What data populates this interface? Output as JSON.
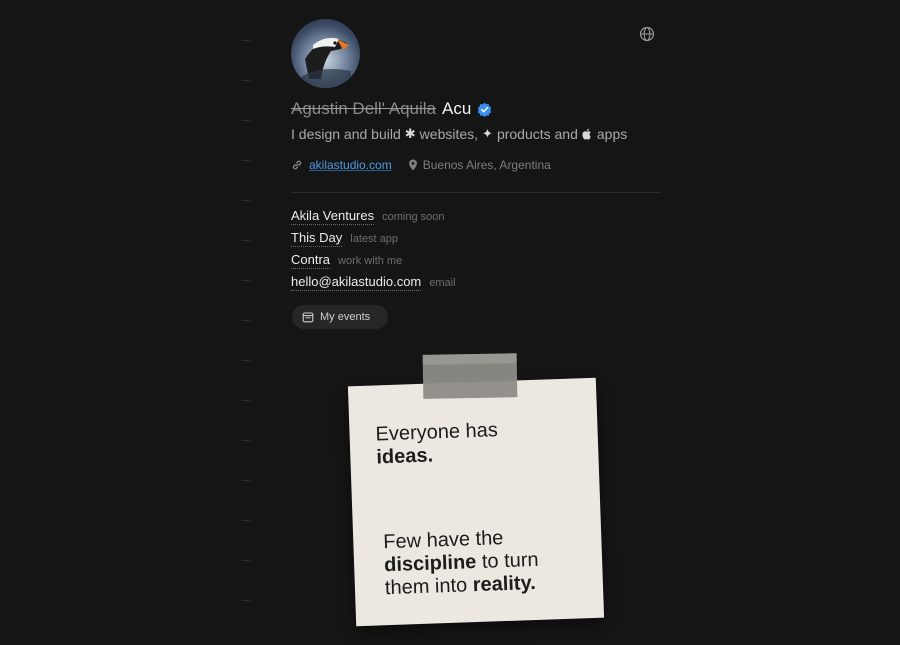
{
  "profile": {
    "name_struck": "Agustin Dell' Aquila",
    "name": "Acu",
    "tagline_1": "I design and build",
    "tagline_2": "websites,",
    "tagline_3": "products and",
    "tagline_4": "apps",
    "website": "akilastudio.com",
    "location": "Buenos Aires, Argentina"
  },
  "links": [
    {
      "title": "Akila Ventures",
      "note": "coming soon"
    },
    {
      "title": "This Day",
      "note": "latest app"
    },
    {
      "title": "Contra",
      "note": "work with me"
    },
    {
      "title": "hello@akilastudio.com",
      "note": "email"
    }
  ],
  "events_button": {
    "label": "My events"
  },
  "note": {
    "l1": "Everyone has",
    "l2": "ideas.",
    "l3a": "Few have the",
    "l3b": "discipline",
    "l3c": " to turn",
    "l4a": "them into ",
    "l4b": "reality."
  },
  "colors": {
    "background": "#151515",
    "link": "#4e9be6",
    "verified": "#3b8ff0",
    "paper": "#ece8e1"
  },
  "icons": [
    "globe-icon",
    "verified-icon",
    "link-icon",
    "location-pin-icon",
    "calendar-icon"
  ]
}
